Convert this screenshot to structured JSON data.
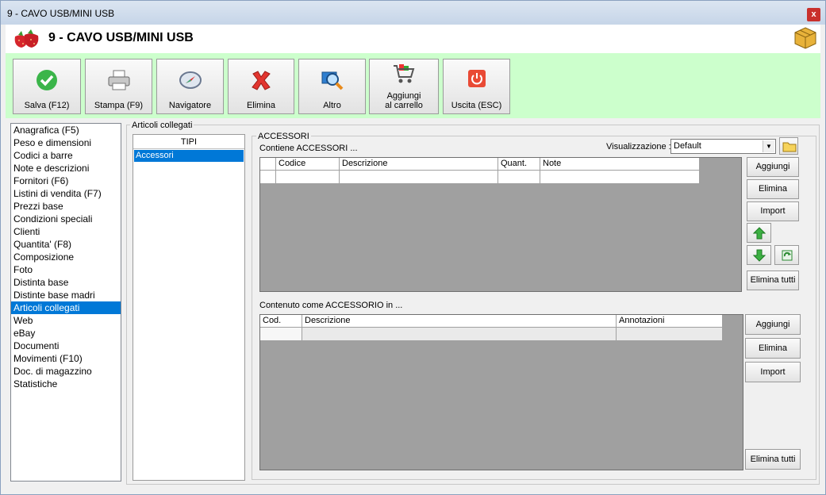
{
  "window": {
    "title": "9 - CAVO USB/MINI USB",
    "close_glyph": "x"
  },
  "header": {
    "title": "9 - CAVO USB/MINI USB",
    "logo_icon": "strawberry-icon",
    "right_icon": "package-box-icon"
  },
  "toolbar": {
    "buttons": [
      {
        "label": "Salva (F12)",
        "icon": "check-icon"
      },
      {
        "label": "Stampa (F9)",
        "icon": "printer-icon"
      },
      {
        "label": "Navigatore",
        "icon": "compass-icon"
      },
      {
        "label": "Elimina",
        "icon": "red-x-icon"
      },
      {
        "label": "Altro",
        "icon": "magnifier-icon"
      },
      {
        "label": "Aggiungi al carrello",
        "icon": "cart-icon"
      },
      {
        "label": "Uscita (ESC)",
        "icon": "power-icon"
      }
    ]
  },
  "nav": {
    "items": [
      "Anagrafica (F5)",
      "Peso e dimensioni",
      "Codici a barre",
      "Note e descrizioni",
      "Fornitori (F6)",
      "Listini di vendita (F7)",
      "Prezzi base",
      "Condizioni speciali",
      "Clienti",
      "Quantita' (F8)",
      "Composizione",
      "Foto",
      "Distinta base",
      "Distinte base madri",
      "Articoli collegati",
      "Web",
      "eBay",
      "Documenti",
      "Movimenti (F10)",
      "Doc. di magazzino",
      "Statistiche"
    ],
    "selected": "Articoli collegati"
  },
  "articoli": {
    "group_label": "Articoli collegati",
    "tipi_header": "TIPI",
    "tipi_items": [
      "Accessori"
    ],
    "accessori_group": "ACCESSORI",
    "contiene_label": "Contiene ACCESSORI ...",
    "visualizzazione_label": "Visualizzazione :",
    "visualizzazione_value": "Default",
    "grid1_columns": [
      "Codice",
      "Descrizione",
      "Quant.",
      "Note"
    ],
    "grid1_buttons": {
      "add": "Aggiungi",
      "remove": "Elimina",
      "import": "Import",
      "remove_all": "Elimina tutti"
    },
    "contenuto_label": "Contenuto come ACCESSORIO in ...",
    "grid2_columns": [
      "Cod.",
      "Descrizione",
      "Annotazioni"
    ],
    "grid2_buttons": {
      "add": "Aggiungi",
      "remove": "Elimina",
      "import": "Import",
      "remove_all": "Elimina tutti"
    }
  },
  "colors": {
    "toolbar_bg": "#ccffcc",
    "selection": "#0078d7",
    "grid_bg": "#a0a0a0"
  }
}
